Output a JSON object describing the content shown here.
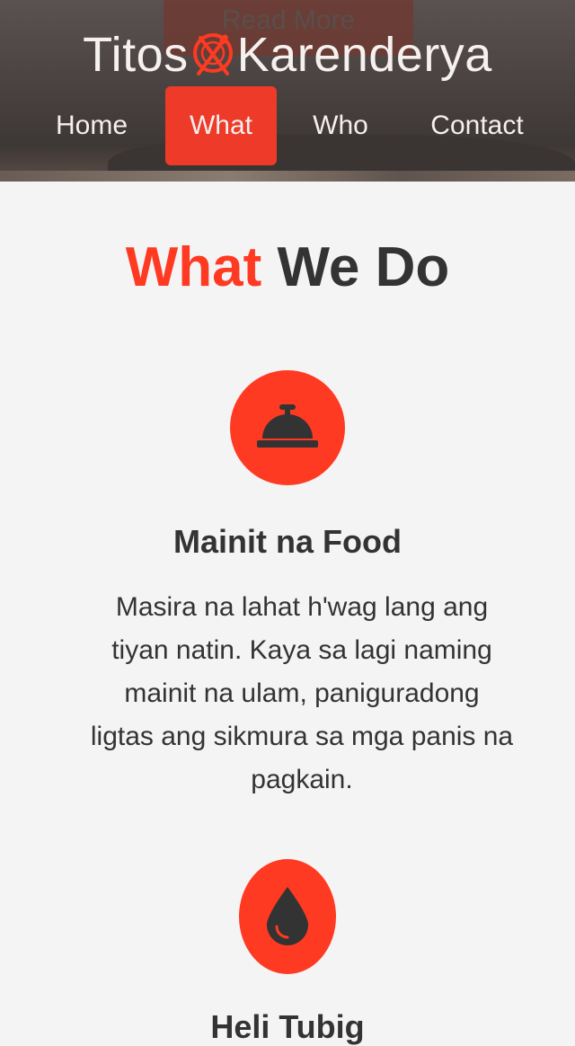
{
  "header": {
    "background_button_label": "Read More",
    "logo": {
      "text_left": "Titos",
      "text_right": "Karenderya",
      "icon": "plate-fork-spoon-icon"
    },
    "nav": [
      {
        "label": "Home",
        "active": false
      },
      {
        "label": "What",
        "active": true
      },
      {
        "label": "Who",
        "active": false
      },
      {
        "label": "Contact",
        "active": false
      }
    ]
  },
  "section": {
    "title_accent": "What",
    "title_rest": "We Do"
  },
  "features": [
    {
      "icon": "service-bell-icon",
      "title": "Mainit na Food",
      "description": "Masira na lahat h'wag lang ang tiyan natin. Kaya sa lagi naming mainit na ulam, paniguradong ligtas ang sikmura sa mga panis na pagkain."
    },
    {
      "icon": "water-drop-icon",
      "title": "Heli Tubig",
      "description": ""
    }
  ],
  "colors": {
    "accent": "#ff3a22",
    "nav_active": "#ee3a28",
    "text_dark": "#333333",
    "background": "#f4f4f4"
  }
}
